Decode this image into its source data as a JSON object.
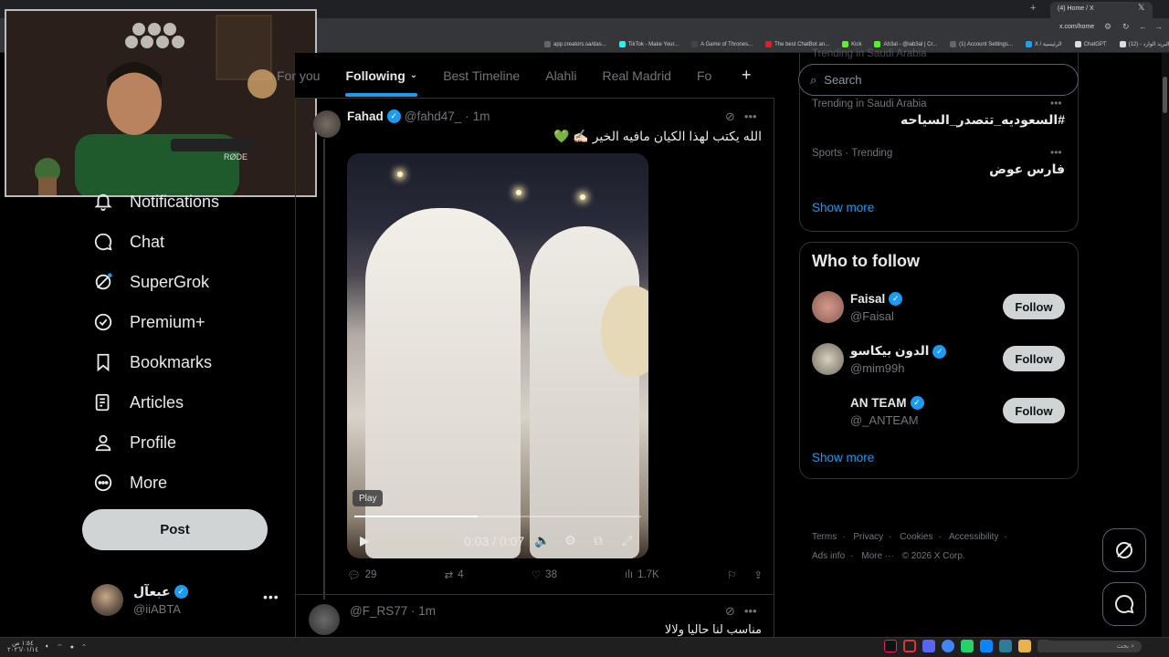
{
  "browser": {
    "active_tab_title": "(4) Home / X",
    "url": "x.com/home",
    "bookmarks": [
      {
        "label": "app.creators.sa/das...",
        "color": "#666"
      },
      {
        "label": "TikTok - Make Your...",
        "color": "#25f4ee"
      },
      {
        "label": "A Game of Thrones...",
        "color": "#444"
      },
      {
        "label": "The best ChatBot an...",
        "color": "#e02020"
      },
      {
        "label": "Kick",
        "color": "#53fc18"
      },
      {
        "label": "Ab3al - @iab3al | Cr...",
        "color": "#53fc18"
      },
      {
        "label": "(1) Account Settings...",
        "color": "#666"
      },
      {
        "label": "X / الرئيسية",
        "color": "#1da1f2"
      },
      {
        "label": "ChatGPT",
        "color": "#ddd"
      },
      {
        "label": "(12) - البريد الوارد - ab...",
        "color": "#ddd"
      }
    ]
  },
  "nav": {
    "items": [
      {
        "label": "Notifications",
        "icon": "bell-icon"
      },
      {
        "label": "Chat",
        "icon": "chat-icon"
      },
      {
        "label": "SuperGrok",
        "icon": "grok-icon"
      },
      {
        "label": "Premium+",
        "icon": "premium-icon"
      },
      {
        "label": "Bookmarks",
        "icon": "bookmark-icon"
      },
      {
        "label": "Articles",
        "icon": "articles-icon"
      },
      {
        "label": "Profile",
        "icon": "profile-icon"
      },
      {
        "label": "More",
        "icon": "more-circle-icon"
      }
    ],
    "post_label": "Post",
    "account": {
      "name": "عبعآل",
      "handle": "@iiABTA"
    }
  },
  "timeline": {
    "tabs": [
      "For you",
      "Following",
      "Best Timeline",
      "Alahli",
      "Real Madrid",
      "Fo"
    ],
    "active_tab": "Following",
    "posts": [
      {
        "name": "Fahad",
        "handle": "@fahd47_",
        "time": "1m",
        "text": "الله يكتب لهذا الكيان مافيه الخير ✍🏻 💚",
        "video": {
          "play_label": "Play",
          "time": "0:03 / 0:07",
          "progress": 0.43
        },
        "replies": "29",
        "reposts": "4",
        "likes": "38",
        "views": "1.7K"
      },
      {
        "handle": "@F_RS77",
        "time": "1m",
        "text": "مناسب لنا حاليا ولالا"
      }
    ]
  },
  "sidebar": {
    "search_placeholder": "Search",
    "trends": [
      {
        "context": "Trending in Saudi Arabia",
        "title": "#السعوديه_تتصدر_السياحه"
      },
      {
        "context": "Sports · Trending",
        "title": "فارس عوض"
      }
    ],
    "trend_cut_header": "Trending in Saudi Arabia",
    "show_more": "Show more",
    "who_to_follow": {
      "title": "Who to follow",
      "accounts": [
        {
          "name": "Faisal",
          "handle": "@Faisal",
          "avatar_color": "#b7857a"
        },
        {
          "name": "الدون بيكاسو",
          "handle": "@mim99h",
          "avatar_color": "#a8a090"
        },
        {
          "name": "AN TEAM",
          "handle": "@_ANTEAM",
          "avatar_color": "#000000"
        }
      ],
      "follow_label": "Follow",
      "show_more": "Show more"
    },
    "footer": [
      "Terms",
      "Privacy",
      "Cookies",
      "Accessibility",
      "Ads info",
      "More ···",
      "© 2026 X Corp."
    ]
  },
  "taskbar": {
    "time": "١:٥٤ ص",
    "date": "٢٠٢٦/٠١/١٤",
    "search_label": "بحث"
  }
}
